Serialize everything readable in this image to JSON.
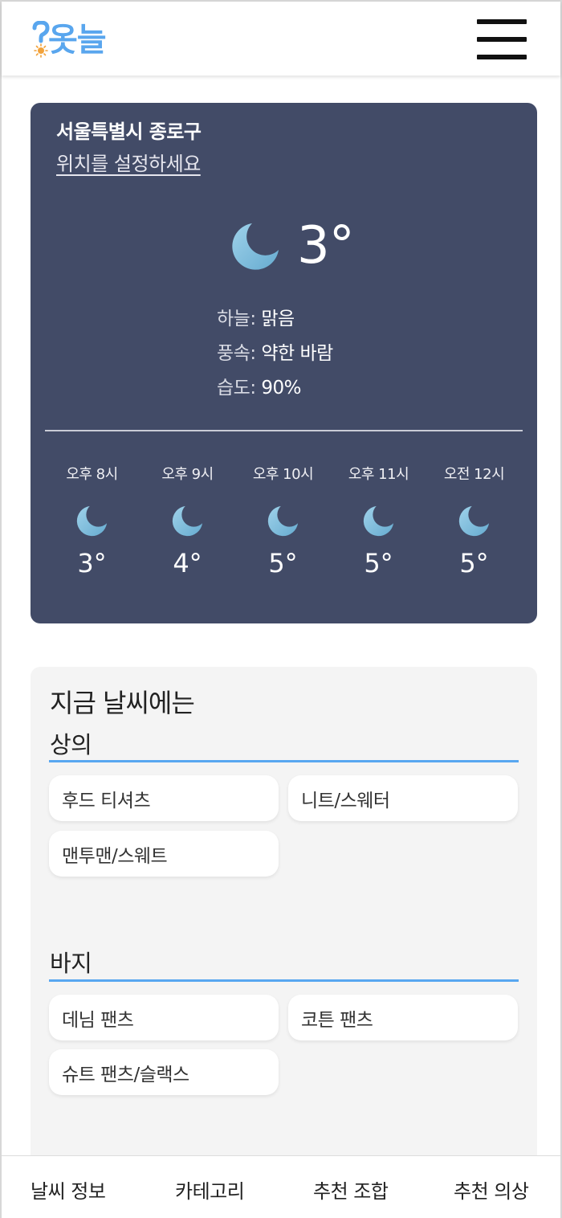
{
  "header": {
    "logo_text": "옷늘",
    "logo_mark": "?"
  },
  "weather": {
    "location": "서울특별시 종로구",
    "location_link": "위치를 설정하세요",
    "current_temp": "3°",
    "icon": "moon-icon",
    "details": [
      {
        "label": "하늘: ",
        "value": "맑음"
      },
      {
        "label": "풍속: ",
        "value": "약한 바람"
      },
      {
        "label": "습도: ",
        "value": "90%"
      }
    ],
    "hourly": [
      {
        "time": "오후 8시",
        "temp": "3°"
      },
      {
        "time": "오후 9시",
        "temp": "4°"
      },
      {
        "time": "오후 10시",
        "temp": "5°"
      },
      {
        "time": "오후 11시",
        "temp": "5°"
      },
      {
        "time": "오전 12시",
        "temp": "5°"
      }
    ]
  },
  "recommend": {
    "title": "지금 날씨에는",
    "sections": [
      {
        "title": "상의",
        "items": [
          "후드 티셔츠",
          "니트/스웨터",
          "맨투맨/스웨트"
        ]
      },
      {
        "title": "바지",
        "items": [
          "데님 팬츠",
          "코튼 팬츠",
          "슈트 팬츠/슬랙스"
        ]
      }
    ]
  },
  "colors": {
    "card_bg": "#424b67",
    "accent": "#58a7f0",
    "moon": "#7ec0dd",
    "panel_bg": "#f4f4f4"
  },
  "nav": {
    "items": [
      "날씨 정보",
      "카테고리",
      "추천 조합",
      "추천 의상"
    ]
  }
}
